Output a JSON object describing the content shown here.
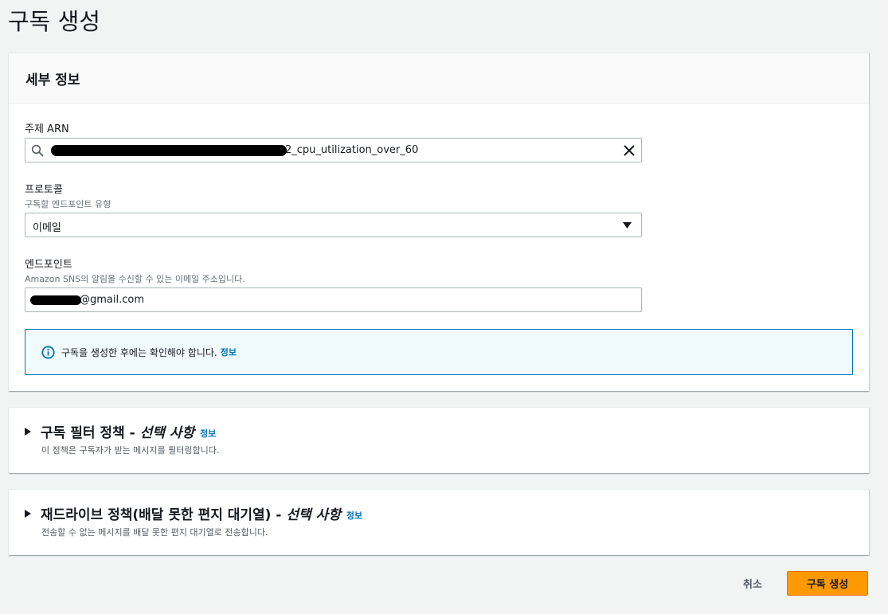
{
  "page": {
    "title": "구독 생성"
  },
  "details": {
    "header": "세부 정보",
    "topic_arn": {
      "label": "주제 ARN",
      "value_visible_suffix": "2_cpu_utilization_over_60"
    },
    "protocol": {
      "label": "프로토콜",
      "description": "구독할 엔드포인트 유형",
      "selected": "이메일"
    },
    "endpoint": {
      "label": "엔드포인트",
      "description": "Amazon SNS의 알림을 수신할 수 있는 이메일 주소입니다.",
      "value_visible_suffix": "@gmail.com"
    },
    "info": {
      "text": "구독을 생성한 후에는 확인해야 합니다.",
      "link": "정보"
    }
  },
  "filter_policy": {
    "title": "구독 필터 정책 - ",
    "optional": "선택 사항",
    "link": "정보",
    "description": "이 정책은 구독자가 받는 메시지를 필터링합니다."
  },
  "redrive_policy": {
    "title": "재드라이브 정책(배달 못한 편지 대기열) - ",
    "optional": "선택 사항",
    "link": "정보",
    "description": "전송할 수 없는 메시지를 배달 못한 편지 대기열로 전송합니다."
  },
  "actions": {
    "cancel": "취소",
    "create": "구독 생성"
  },
  "colors": {
    "primary": "#ff9900",
    "link": "#0073bb",
    "info_bg": "#f1faff"
  },
  "icons": [
    "search-icon",
    "clear-icon",
    "dropdown-caret-icon",
    "info-icon",
    "expand-caret-icon"
  ]
}
